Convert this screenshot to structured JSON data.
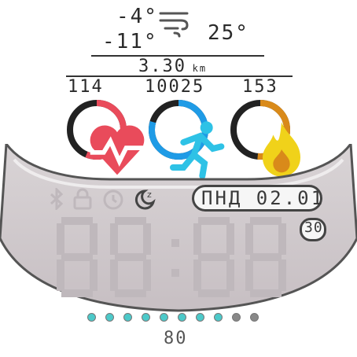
{
  "weather": {
    "temp_high": "-4°",
    "temp_low": "-11°",
    "temp_current": "25°",
    "icon": "wind-icon"
  },
  "distance": {
    "value": "3.30",
    "unit": "km"
  },
  "stats": [
    {
      "value": "114",
      "icon": "heart-icon",
      "color": "#e94b5b",
      "progress": 0.55
    },
    {
      "value": "10025",
      "icon": "running-icon",
      "color": "#1f9be6",
      "progress": 0.8
    },
    {
      "value": "153",
      "icon": "flame-icon",
      "color": "#d98a1a",
      "progress": 0.5
    }
  ],
  "status_icons": [
    "bluetooth-icon",
    "lock-icon",
    "alarm-icon",
    "sleep-icon"
  ],
  "date": "ПНД 02.01",
  "day_badge": "30",
  "time": "88:88",
  "battery": {
    "level": "80",
    "dots_total": 10,
    "dots_filled": 8,
    "fill_color": "#4cc9c9"
  }
}
